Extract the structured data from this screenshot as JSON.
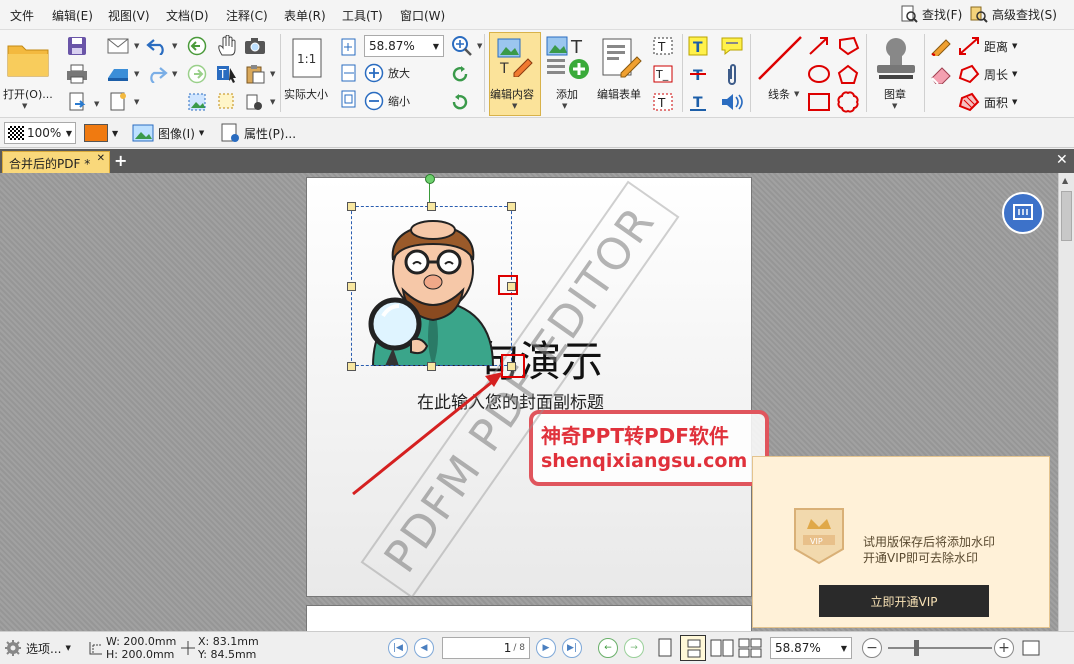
{
  "menu": {
    "items": [
      "文件",
      "编辑(E)",
      "视图(V)",
      "文档(D)",
      "注释(C)",
      "表单(R)",
      "工具(T)",
      "窗口(W)"
    ],
    "find": "查找(F)",
    "advanced_find": "高级查找(S)"
  },
  "ribbon": {
    "open": "打开(O)...",
    "actual_size": "实际大小",
    "zoom_value": "58.87%",
    "zoom_in": "放大",
    "zoom_out": "缩小",
    "edit_content": "编辑内容",
    "add": "添加",
    "edit_form": "编辑表单",
    "lines": "线条",
    "stamp": "图章",
    "distance": "距离",
    "perimeter": "周长",
    "area": "面积"
  },
  "toolbar2": {
    "opacity": "100%",
    "image": "图像(I)",
    "properties": "属性(P)..."
  },
  "tab": {
    "label": "合并后的PDF *"
  },
  "page": {
    "title": "一句演示",
    "subtitle": "在此输入您的封面副标题",
    "stamp_line1": "神奇PPT转PDF软件",
    "stamp_line2": "shenqixiangsu.com",
    "watermark": "PDFM PDF EDITOR"
  },
  "vip": {
    "line1": "试用版保存后将添加水印",
    "line2": "开通VIP即可去除水印",
    "button": "立即开通VIP",
    "badge": "VIP"
  },
  "status": {
    "options": "选项...",
    "width": "W: 200.0mm",
    "height": "H: 200.0mm",
    "x": "X:   83.1mm",
    "y": "Y:   84.5mm",
    "page_current": "1",
    "page_total": "/ 8",
    "zoom": "58.87%"
  },
  "colors": {
    "accent": "#f9d87b",
    "red": "#d00000",
    "blue": "#3d72c9"
  }
}
